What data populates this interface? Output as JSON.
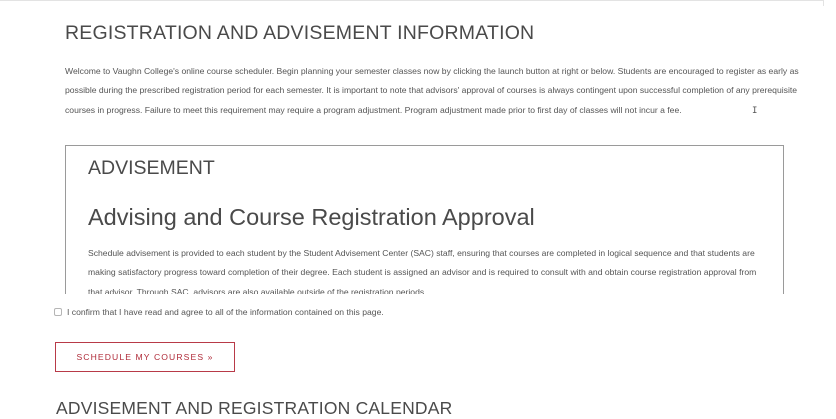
{
  "registration": {
    "title": "REGISTRATION AND ADVISEMENT INFORMATION",
    "intro": "Welcome to Vaughn College's online course scheduler. Begin planning your semester classes now by clicking the launch button at right or below. Students are encouraged to register as early as possible during the prescribed registration period for each semester. It is important to note that advisors' approval of courses is always contingent upon successful completion of any prerequisite courses in progress. Failure to meet this requirement may require a program adjustment. Program adjustment made prior to first day of classes will not incur a fee."
  },
  "advisement": {
    "heading": "ADVISEMENT",
    "subheading": "Advising and Course Registration Approval",
    "body": "Schedule advisement is provided to each student by the Student Advisement Center (SAC) staff, ensuring that courses are completed in logical sequence and that students are making satisfactory progress toward completion of their degree. Each student is assigned an advisor and is required to consult with and obtain course registration approval from that advisor. Through SAC, advisors are also available outside of the registration periods."
  },
  "confirm": {
    "checked": false,
    "label": "I confirm that I have read and agree to all of the information contained on this page."
  },
  "actions": {
    "schedule_label": "SCHEDULE MY COURSES »"
  },
  "calendar": {
    "title": "ADVISEMENT AND REGISTRATION CALENDAR"
  },
  "colors": {
    "accent": "#b02c3a",
    "box_border": "#9a9a9a",
    "text": "#555555"
  }
}
